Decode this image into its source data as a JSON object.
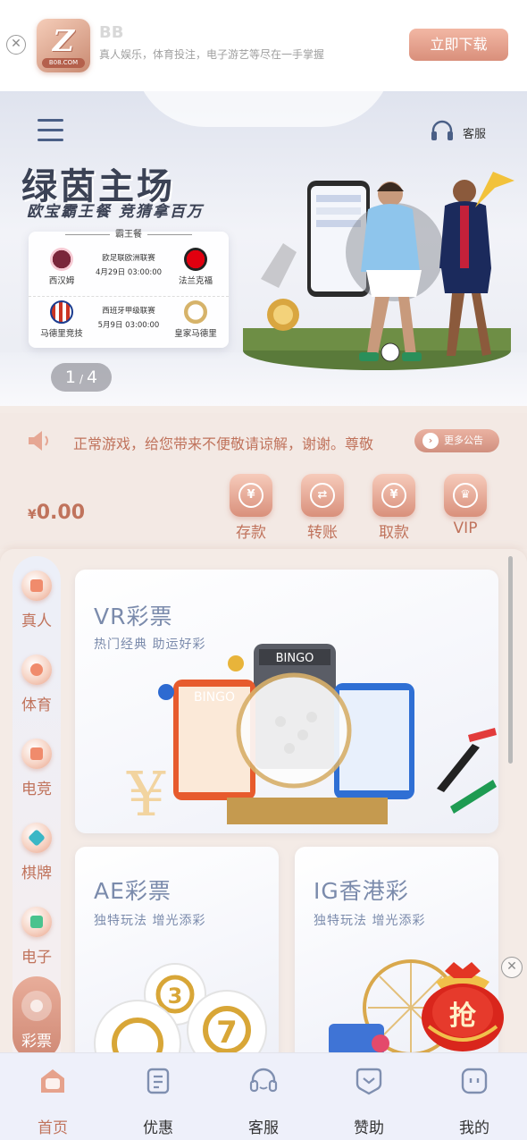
{
  "download_bar": {
    "app_name": "BB",
    "logo_text": "B08.COM",
    "description": "真人娱乐，体育投注，电子游艺等尽在一手掌握",
    "download_label": "立即下载",
    "close_icon": "✕"
  },
  "hero": {
    "title": "绿茵主场",
    "subtitle": "欧宝霸王餐  竞猜拿百万",
    "customer_service_label": "客服",
    "card_title": "霸王餐",
    "matches": [
      {
        "league": "欧足联欧洲联赛",
        "time": "4月29日 03:00:00",
        "home": "西汉姆",
        "away": "法兰克福",
        "home_color": "#7a263a",
        "away_color": "#e1000f"
      },
      {
        "league": "西班牙甲级联赛",
        "time": "5月9日 03:00:00",
        "home": "马德里竞技",
        "away": "皇家马德里",
        "home_color": "#cb3524",
        "away_color": "#d6b36a"
      }
    ],
    "slide_current": "1",
    "slide_total": "4"
  },
  "notice": {
    "text": "正常游戏，给您带来不便敬请谅解，谢谢。尊敬",
    "more_label": "更多公告"
  },
  "wallet": {
    "currency": "¥",
    "balance": "0.00",
    "actions": [
      {
        "label": "存款",
        "icon": "deposit-icon",
        "glyph": "¥"
      },
      {
        "label": "转账",
        "icon": "transfer-icon",
        "glyph": "⇄"
      },
      {
        "label": "取款",
        "icon": "withdraw-icon",
        "glyph": "¥"
      },
      {
        "label": "VIP",
        "icon": "vip-icon",
        "glyph": "♛"
      }
    ]
  },
  "sidebar": {
    "items": [
      {
        "label": "真人",
        "icon": "live-casino-icon"
      },
      {
        "label": "体育",
        "icon": "sports-icon"
      },
      {
        "label": "电竞",
        "icon": "esports-icon"
      },
      {
        "label": "棋牌",
        "icon": "chess-cards-icon"
      },
      {
        "label": "电子",
        "icon": "slots-icon"
      },
      {
        "label": "彩票",
        "icon": "lottery-icon"
      }
    ],
    "active_index": 5
  },
  "lottery_cards": [
    {
      "title": "VR彩票",
      "subtitle": "热门经典 助运好彩",
      "bingo_label": "BINGO"
    },
    {
      "title": "AE彩票",
      "subtitle": "独特玩法 增光添彩"
    },
    {
      "title": "IG香港彩",
      "subtitle": "独特玩法 增光添彩"
    }
  ],
  "red_envelope": {
    "label": "抢"
  },
  "tabbar": {
    "items": [
      {
        "label": "首页",
        "icon": "home-icon"
      },
      {
        "label": "优惠",
        "icon": "promo-icon"
      },
      {
        "label": "客服",
        "icon": "headset-icon"
      },
      {
        "label": "赞助",
        "icon": "sponsor-icon"
      },
      {
        "label": "我的",
        "icon": "profile-icon"
      }
    ],
    "active_index": 0
  },
  "colors": {
    "accent": "#c0735c",
    "accent_light": "#e8ad9a",
    "title_blue": "#7b8bac"
  }
}
